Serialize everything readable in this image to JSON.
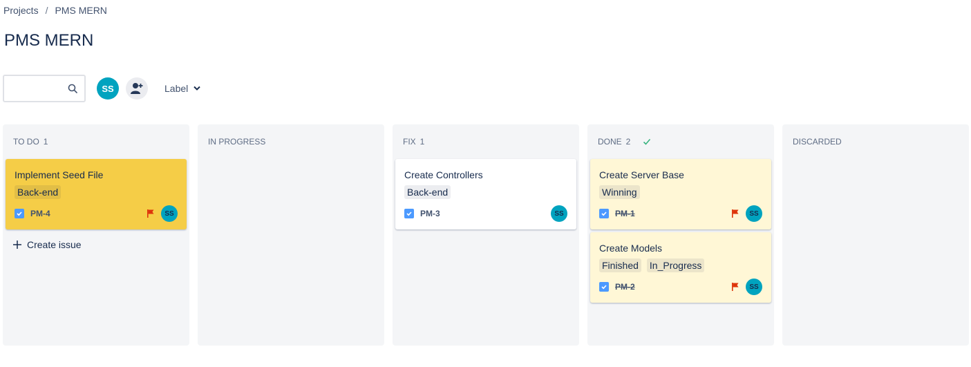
{
  "breadcrumb": {
    "projects": "Projects",
    "separator": "/",
    "current": "PMS MERN"
  },
  "page_title": "PMS MERN",
  "toolbar": {
    "search_value": "",
    "search_placeholder": "",
    "user_initials": "SS",
    "label_filter": "Label"
  },
  "columns": [
    {
      "name": "TO DO",
      "count": "1",
      "create_issue": "Create issue",
      "cards": [
        {
          "title": "Implement Seed File",
          "labels": [
            "Back-end"
          ],
          "key": "PM-4",
          "assignee": "SS"
        }
      ]
    },
    {
      "name": "IN PROGRESS",
      "count": ""
    },
    {
      "name": "FIX",
      "count": "1",
      "cards": [
        {
          "title": "Create Controllers",
          "labels": [
            "Back-end"
          ],
          "key": "PM-3",
          "assignee": "SS"
        }
      ]
    },
    {
      "name": "DONE",
      "count": "2",
      "cards": [
        {
          "title": "Create Server Base",
          "labels": [
            "Winning"
          ],
          "key": "PM-1",
          "assignee": "SS"
        },
        {
          "title": "Create Models",
          "labels": [
            "Finished",
            "In_Progress"
          ],
          "key": "PM-2",
          "assignee": "SS"
        }
      ]
    },
    {
      "name": "DISCARDED",
      "count": ""
    }
  ],
  "colors": {
    "accent_avatar": "#00a3bf",
    "card_highlight": "#f5cd47",
    "card_done": "#fff7d6",
    "flag": "#de350b",
    "done_check": "#36b37e",
    "checkbox": "#4c9aff"
  },
  "icons": [
    "search-icon",
    "add-user-icon",
    "chevron-down-icon",
    "check-icon",
    "flag-icon",
    "checkbox-icon",
    "plus-icon"
  ]
}
